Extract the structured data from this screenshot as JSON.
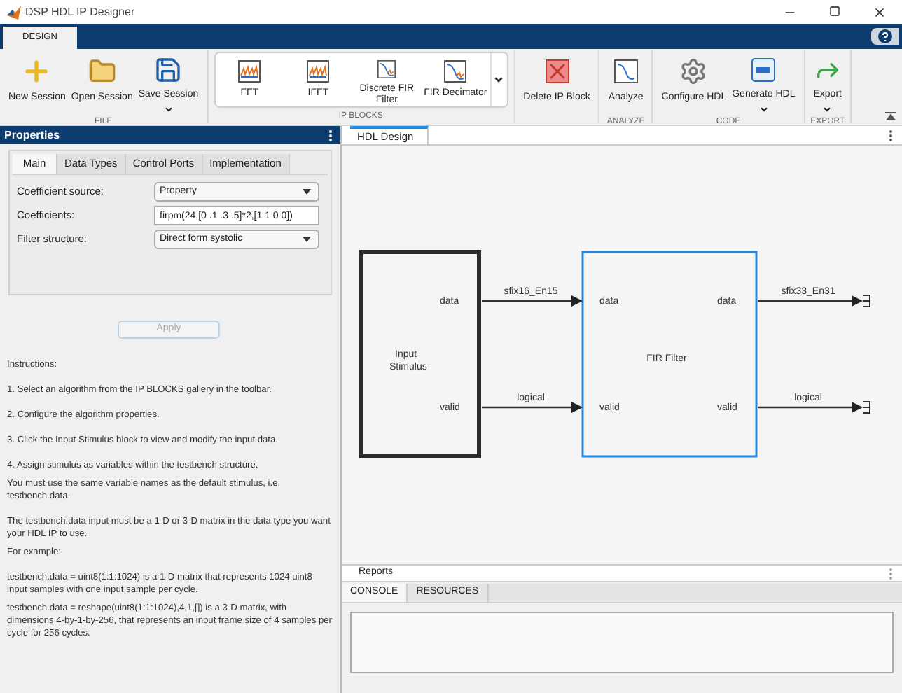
{
  "window": {
    "title": "DSP HDL IP Designer"
  },
  "ribbon": {
    "tabs": [
      {
        "label": "DESIGN",
        "selected": true
      }
    ],
    "sections": [
      {
        "title": "FILE",
        "kind": "buttons",
        "items": [
          {
            "label": "New Session",
            "dropdown": false
          },
          {
            "label": "Open Session",
            "dropdown": false
          },
          {
            "label": "Save Session",
            "dropdown": true
          }
        ]
      },
      {
        "title": "IP BLOCKS",
        "kind": "gallery",
        "items": [
          {
            "label": "FFT"
          },
          {
            "label": "IFFT"
          },
          {
            "label": "Discrete FIR Filter"
          },
          {
            "label": "FIR Decimator"
          }
        ]
      },
      {
        "kind": "buttons",
        "items": [
          {
            "label": "Delete IP Block",
            "dropdown": false
          }
        ]
      },
      {
        "title": "ANALYZE",
        "kind": "buttons",
        "items": [
          {
            "label": "Analyze",
            "dropdown": false
          }
        ]
      },
      {
        "title": "CODE",
        "kind": "buttons",
        "items": [
          {
            "label": "Configure HDL",
            "dropdown": false
          },
          {
            "label": "Generate HDL",
            "dropdown": true
          }
        ]
      },
      {
        "title": "EXPORT",
        "kind": "buttons",
        "items": [
          {
            "label": "Export",
            "dropdown": true
          }
        ]
      }
    ]
  },
  "properties": {
    "title": "Properties",
    "tabs": [
      {
        "label": "Main",
        "selected": true
      },
      {
        "label": "Data Types",
        "selected": false
      },
      {
        "label": "Control Ports",
        "selected": false
      },
      {
        "label": "Implementation",
        "selected": false
      }
    ],
    "fields": [
      {
        "kind": "select",
        "label": "Coefficient source:",
        "value": "Property"
      },
      {
        "kind": "text",
        "label": "Coefficients:",
        "value": "firpm(24,[0 .1 .3 .5]*2,[1 1 0 0])"
      },
      {
        "kind": "select",
        "label": "Filter structure:",
        "value": "Direct form systolic"
      }
    ],
    "apply": {
      "label": "Apply",
      "disabled": true
    },
    "instructions": [
      "Instructions:",
      "1. Select an algorithm from the IP BLOCKS gallery in the toolbar.",
      "2. Configure the algorithm properties.",
      "3. Click the Input Stimulus block to view and modify the input data.",
      "4. Assign stimulus as variables within the testbench structure.",
      "You must use the same variable names as the default stimulus, i.e. testbench.data.",
      "The testbench.data input must be a 1-D or 3-D matrix in the data type you want your HDL IP to use.",
      "For example:",
      "testbench.data = uint8(1:1:1024) is a 1-D matrix that represents 1024 uint8 input samples with one input sample per cycle.",
      "testbench.data = reshape(uint8(1:1:1024),4,1,[]) is a 3-D matrix, with dimensions 4-by-1-by-256, that represents an input frame size of 4 samples per cycle for 256 cycles."
    ]
  },
  "design": {
    "tabs": [
      {
        "label": "HDL Design",
        "selected": true
      }
    ],
    "blocks": [
      {
        "label": "Input Stimulus",
        "selected": false,
        "outputs": [
          "data",
          "valid"
        ]
      },
      {
        "label": "FIR Filter",
        "selected": true,
        "inputs": [
          "data",
          "valid"
        ],
        "outputs": [
          "data",
          "valid"
        ]
      }
    ],
    "signals_in": [
      "sfix16_En15",
      "logical"
    ],
    "signals_out": [
      "sfix33_En31",
      "logical"
    ]
  },
  "reports": {
    "title": "Reports",
    "tabs": [
      {
        "label": "CONSOLE",
        "selected": true
      },
      {
        "label": "RESOURCES",
        "selected": false
      }
    ]
  }
}
